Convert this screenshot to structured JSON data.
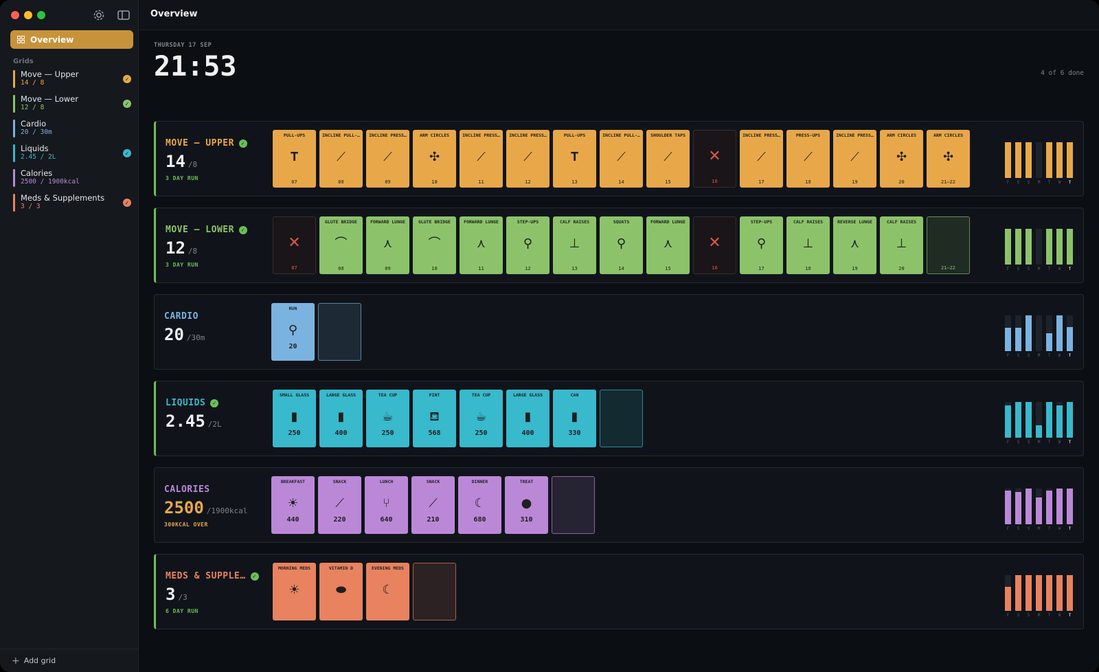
{
  "window": {
    "title": "Overview"
  },
  "sidebar": {
    "nav_selected": "Overview",
    "section_header": "Grids",
    "items": [
      {
        "name": "Move — Upper",
        "value": "14 / 8",
        "color": "#e8a84a",
        "check_color": "#e8a84a"
      },
      {
        "name": "Move — Lower",
        "value": "12 / 8",
        "color": "#8cc36a",
        "check_color": "#8cc36a"
      },
      {
        "name": "Cardio",
        "value": "20 / 30m",
        "color": "#7ab3e0",
        "check_color": ""
      },
      {
        "name": "Liquids",
        "value": "2.45 / 2L",
        "color": "#38b9cc",
        "check_color": "#38b9cc"
      },
      {
        "name": "Calories",
        "value": "2500 / 1900kcal",
        "color": "#bb88d8",
        "check_color": ""
      },
      {
        "name": "Meds & Supplements",
        "value": "3 / 3",
        "color": "#e8825f",
        "check_color": "#e8825f"
      }
    ],
    "add_grid": "Add grid"
  },
  "header": {
    "date": "THURSDAY 17 SEP",
    "time": "21:53",
    "done": "4 of 6 done"
  },
  "cards": [
    {
      "title": "MOVE — UPPER",
      "value": "14",
      "goal": "/8",
      "sub": "3 DAY RUN",
      "color": "#e8a84a",
      "sub_color": "#6bbf59",
      "done": true,
      "tiles": [
        {
          "label": "PULL-UPS",
          "icon": "pullup-icon",
          "glyph": "𝐓",
          "num": "07"
        },
        {
          "label": "INCLINE PULL-…",
          "icon": "incline-pull-icon",
          "glyph": "⟋",
          "num": "08"
        },
        {
          "label": "INCLINE PRESS…",
          "icon": "incline-press-icon",
          "glyph": "⟋",
          "num": "09"
        },
        {
          "label": "ARM CIRCLES",
          "icon": "arm-circles-icon",
          "glyph": "✣",
          "num": "10"
        },
        {
          "label": "INCLINE PRESS…",
          "icon": "incline-press-icon",
          "glyph": "⟋",
          "num": "11"
        },
        {
          "label": "INCLINE PRESS…",
          "icon": "incline-press-icon",
          "glyph": "⟋",
          "num": "12"
        },
        {
          "label": "PULL-UPS",
          "icon": "pullup-icon",
          "glyph": "𝐓",
          "num": "13"
        },
        {
          "label": "INCLINE PULL-…",
          "icon": "incline-pull-icon",
          "glyph": "⟋",
          "num": "14"
        },
        {
          "label": "SHOULDER TAPS",
          "icon": "shoulder-taps-icon",
          "glyph": "⟋",
          "num": "15"
        },
        {
          "label": "",
          "icon": "missed-icon",
          "glyph": "✕",
          "num": "16",
          "miss": true
        },
        {
          "label": "INCLINE PRESS…",
          "icon": "incline-press-icon",
          "glyph": "⟋",
          "num": "17"
        },
        {
          "label": "PRESS-UPS",
          "icon": "press-ups-icon",
          "glyph": "⟋",
          "num": "18"
        },
        {
          "label": "INCLINE PRESS…",
          "icon": "incline-press-icon",
          "glyph": "⟋",
          "num": "19"
        },
        {
          "label": "ARM CIRCLES",
          "icon": "arm-circles-icon",
          "glyph": "✣",
          "num": "20"
        },
        {
          "label": "ARM CIRCLES",
          "icon": "arm-circles-icon",
          "glyph": "✣",
          "num": "21–22"
        }
      ],
      "spark": [
        1,
        1,
        1,
        0,
        1,
        1,
        1
      ]
    },
    {
      "title": "MOVE — LOWER",
      "value": "12",
      "goal": "/8",
      "sub": "3 DAY RUN",
      "color": "#8cc36a",
      "sub_color": "#6bbf59",
      "done": true,
      "tiles": [
        {
          "label": "",
          "icon": "missed-icon",
          "glyph": "✕",
          "num": "07",
          "miss": true
        },
        {
          "label": "GLUTE BRIDGE",
          "icon": "glute-bridge-icon",
          "glyph": "⌒",
          "num": "08"
        },
        {
          "label": "FORWARD LUNGE",
          "icon": "lunge-icon",
          "glyph": "⋏",
          "num": "09"
        },
        {
          "label": "GLUTE BRIDGE",
          "icon": "glute-bridge-icon",
          "glyph": "⌒",
          "num": "10"
        },
        {
          "label": "FORWARD LUNGE",
          "icon": "lunge-icon",
          "glyph": "⋏",
          "num": "11"
        },
        {
          "label": "STEP-UPS",
          "icon": "step-ups-icon",
          "glyph": "⚲",
          "num": "12"
        },
        {
          "label": "CALF RAISES",
          "icon": "calf-raises-icon",
          "glyph": "⊥",
          "num": "13"
        },
        {
          "label": "SQUATS",
          "icon": "squats-icon",
          "glyph": "⚲",
          "num": "14"
        },
        {
          "label": "FORWARD LUNGE",
          "icon": "lunge-icon",
          "glyph": "⋏",
          "num": "15"
        },
        {
          "label": "",
          "icon": "missed-icon",
          "glyph": "✕",
          "num": "16",
          "miss": true
        },
        {
          "label": "STEP-UPS",
          "icon": "step-ups-icon",
          "glyph": "⚲",
          "num": "17"
        },
        {
          "label": "CALF RAISES",
          "icon": "calf-raises-icon",
          "glyph": "⊥",
          "num": "18"
        },
        {
          "label": "REVERSE LUNGE",
          "icon": "lunge-icon",
          "glyph": "⋏",
          "num": "19"
        },
        {
          "label": "CALF RAISES",
          "icon": "calf-raises-icon",
          "glyph": "⊥",
          "num": "20"
        },
        {
          "label": "",
          "icon": "",
          "glyph": "",
          "num": "21–22",
          "empty": true
        }
      ],
      "spark": [
        1,
        1,
        1,
        0,
        1,
        1,
        1
      ]
    },
    {
      "title": "CARDIO",
      "value": "20",
      "goal": "/30m",
      "sub": "",
      "color": "#7ab3e0",
      "sub_color": "#6bbf59",
      "done": false,
      "tiles": [
        {
          "label": "RUN",
          "icon": "run-icon",
          "glyph": "⚲",
          "amount": "20"
        },
        {
          "label": "",
          "icon": "",
          "glyph": "",
          "empty": true
        }
      ],
      "spark": [
        0.65,
        0.65,
        1,
        0,
        0.5,
        1,
        0.67
      ]
    },
    {
      "title": "LIQUIDS",
      "value": "2.45",
      "goal": "/2L",
      "sub": "",
      "color": "#38b9cc",
      "sub_color": "#6bbf59",
      "done": true,
      "tiles": [
        {
          "label": "SMALL GLASS",
          "icon": "glass-icon",
          "glyph": "▮",
          "amount": "250"
        },
        {
          "label": "LARGE GLASS",
          "icon": "glass-icon",
          "glyph": "▮",
          "amount": "400"
        },
        {
          "label": "TEA CUP",
          "icon": "teacup-icon",
          "glyph": "☕",
          "amount": "250"
        },
        {
          "label": "PINT",
          "icon": "pint-icon",
          "glyph": "⛾",
          "amount": "568"
        },
        {
          "label": "TEA CUP",
          "icon": "teacup-icon",
          "glyph": "☕",
          "amount": "250"
        },
        {
          "label": "LARGE GLASS",
          "icon": "glass-icon",
          "glyph": "▮",
          "amount": "400"
        },
        {
          "label": "CAN",
          "icon": "can-icon",
          "glyph": "▮",
          "amount": "330"
        },
        {
          "label": "",
          "icon": "",
          "glyph": "",
          "empty": true
        }
      ],
      "spark": [
        0.9,
        1,
        1,
        0.35,
        1,
        0.9,
        1
      ]
    },
    {
      "title": "CALORIES",
      "value": "2500",
      "goal": "/1900kcal",
      "sub": "300KCAL OVER",
      "color": "#bb88d8",
      "value_color": "#e8a84a",
      "sub_color": "#e8a84a",
      "done": false,
      "tiles": [
        {
          "label": "BREAKFAST",
          "icon": "sun-icon",
          "glyph": "☀",
          "amount": "440"
        },
        {
          "label": "SNACK",
          "icon": "carrot-icon",
          "glyph": "⟋",
          "amount": "220"
        },
        {
          "label": "LUNCH",
          "icon": "fork-knife-icon",
          "glyph": "⑂",
          "amount": "640"
        },
        {
          "label": "SNACK",
          "icon": "carrot-icon",
          "glyph": "⟋",
          "amount": "210"
        },
        {
          "label": "DINNER",
          "icon": "moon-icon",
          "glyph": "☾",
          "amount": "680"
        },
        {
          "label": "TREAT",
          "icon": "cookie-icon",
          "glyph": "●",
          "amount": "310"
        },
        {
          "label": "",
          "icon": "",
          "glyph": "",
          "empty": true
        }
      ],
      "spark": [
        0.95,
        0.9,
        1,
        0.75,
        0.95,
        1,
        1
      ]
    },
    {
      "title": "MEDS & SUPPLE…",
      "value": "3",
      "goal": "/3",
      "sub": "6 DAY RUN",
      "color": "#e8825f",
      "sub_color": "#6bbf59",
      "done": true,
      "tiles": [
        {
          "label": "MORNING MEDS",
          "icon": "sun-icon",
          "glyph": "☀"
        },
        {
          "label": "VITAMIN D",
          "icon": "pill-icon",
          "glyph": "⬬"
        },
        {
          "label": "EVENING MEDS",
          "icon": "moon-icon",
          "glyph": "☾"
        },
        {
          "label": "",
          "icon": "",
          "glyph": "",
          "empty": true
        }
      ],
      "spark": [
        0.67,
        1,
        1,
        1,
        1,
        1,
        1
      ]
    }
  ],
  "weekdays": [
    "F",
    "S",
    "S",
    "M",
    "T",
    "W",
    "T"
  ]
}
